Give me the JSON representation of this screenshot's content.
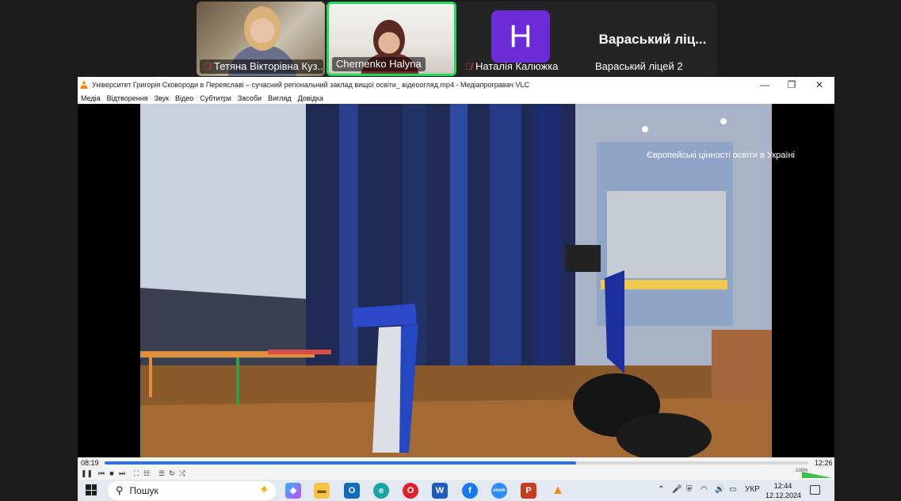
{
  "zoom": {
    "participants": [
      {
        "name": "Тетяна Вікторівна Куз...",
        "muted": true
      },
      {
        "name": "Chernenko Halyna",
        "muted": false,
        "active_speaker": true
      },
      {
        "name": "Наталія Калюжка",
        "muted": true,
        "avatar_letter": "H",
        "avatar_color": "#6b2bd6"
      },
      {
        "name": "Вараський ліцей 2",
        "display_title": "Вараський ліц..."
      }
    ]
  },
  "vlc": {
    "title": "Університет Григорія Сковороди в Переяславі – сучасний регіональний заклад вищої освіти_ відеоогляд.mp4 - Медіапрогравач VLC",
    "menu": [
      "Медіа",
      "Відтворення",
      "Звук",
      "Відео",
      "Субтитри",
      "Засоби",
      "Вигляд",
      "Довідка"
    ],
    "elapsed": "08:19",
    "duration": "12:26",
    "progress": 0.67,
    "volume": "100%",
    "banner_text": "Європейські цінності освіти в Україні",
    "colors": {
      "accent": "#2d73d9",
      "volume": "#39c047"
    }
  },
  "taskbar": {
    "search_placeholder": "Пошук",
    "language": "УКР",
    "time": "12:44",
    "date": "12.12.2024",
    "apps": [
      "copilot-icon",
      "file-explorer-icon",
      "outlook-icon",
      "edge-icon",
      "opera-icon",
      "word-icon",
      "facebook-icon",
      "zoom-icon",
      "powerpoint-icon",
      "vlc-icon"
    ]
  }
}
